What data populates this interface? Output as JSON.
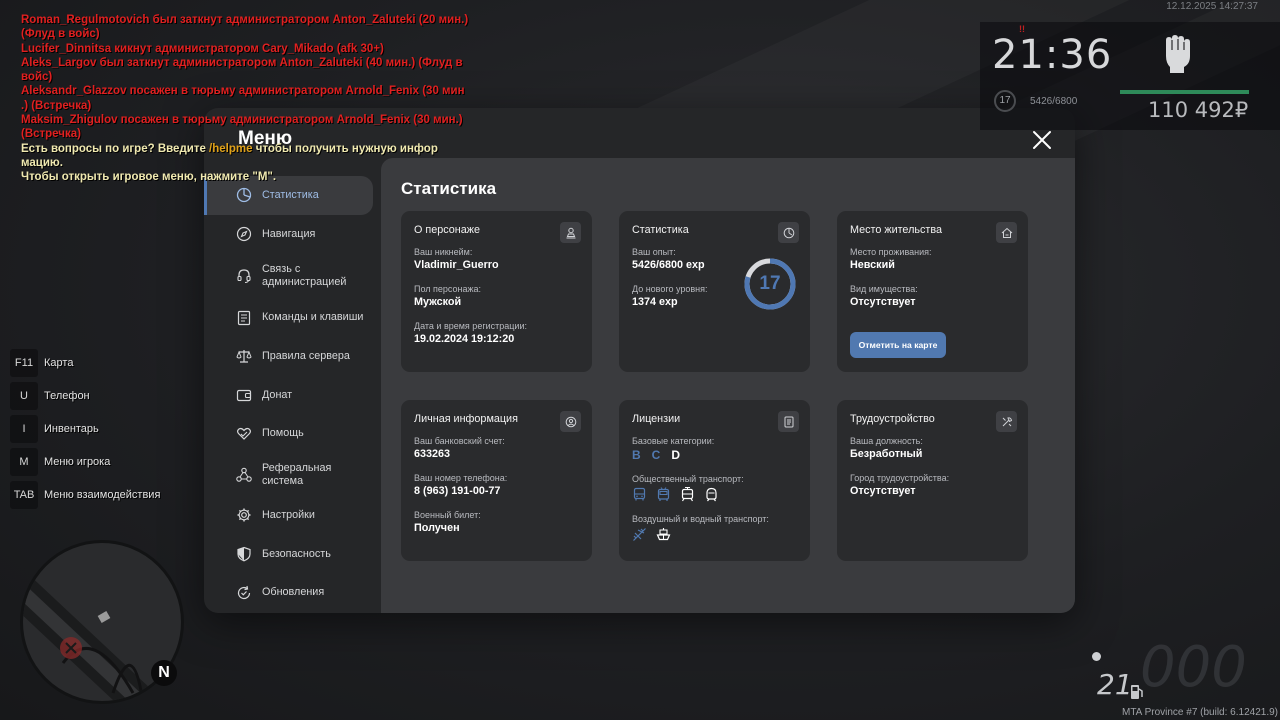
{
  "chat": [
    {
      "color": "red",
      "text": "Roman_Regulmotovich был заткнут администратором Anton_Zaluteki (20 мин.)"
    },
    {
      "color": "red",
      "text": " (Флуд в войс)"
    },
    {
      "color": "red",
      "text": "Lucifer_Dinnitsa кикнут администратором Cary_Mikado (afk 30+)"
    },
    {
      "color": "red",
      "text": "Aleks_Largov был заткнут администратором Anton_Zaluteki (40 мин.) (Флуд в"
    },
    {
      "color": "red",
      "text": " войс)"
    },
    {
      "color": "red",
      "text": "Aleksandr_Glazzov посажен в тюрьму администратором Arnold_Fenix (30 мин"
    },
    {
      "color": "red",
      "text": ".) (Встречка)"
    },
    {
      "color": "red",
      "text": "Maksim_Zhigulov посажен в тюрьму администратором Arnold_Fenix (30 мин.)"
    },
    {
      "color": "red",
      "text": " (Встречка)"
    }
  ],
  "chat_help": {
    "prefix": "Есть вопросы по игре? Введите ",
    "command": "/helpme",
    "suffix": " чтобы получить нужную инфор",
    "line2": "мацию.",
    "line3": "Чтобы открыть игровое меню, нажмите \"M\"."
  },
  "hud": {
    "datetime": "12.12.2025 14:27:37",
    "marker": "!!",
    "time": "21:36",
    "level": "17",
    "exp": "5426/6800",
    "money": "110 492₽",
    "health_fraction": 0.95
  },
  "hints": [
    {
      "key": "F11",
      "label": "Карта"
    },
    {
      "key": "U",
      "label": "Телефон"
    },
    {
      "key": "I",
      "label": "Инвентарь"
    },
    {
      "key": "M",
      "label": "Меню игрока"
    },
    {
      "key": "TAB",
      "label": "Меню взаимодействия"
    }
  ],
  "minimap": {
    "north": "N"
  },
  "speedo": {
    "digits": "000",
    "fuel": "21"
  },
  "build": "MTA Province #7 (build: 6.12421.9)",
  "menu": {
    "title": "Меню",
    "sidebar": [
      {
        "label": "Статистика",
        "icon": "pie-chart-icon",
        "active": true
      },
      {
        "label": "Навигация",
        "icon": "compass-icon"
      },
      {
        "label": "Связь с администрацией",
        "icon": "headset-icon"
      },
      {
        "label": "Команды и клавиши",
        "icon": "list-icon"
      },
      {
        "label": "Правила сервера",
        "icon": "scales-icon"
      },
      {
        "label": "Донат",
        "icon": "wallet-icon"
      },
      {
        "label": "Помощь",
        "icon": "heart-hand-icon"
      },
      {
        "label": "Реферальная система",
        "icon": "network-icon"
      },
      {
        "label": "Настройки",
        "icon": "gear-icon"
      },
      {
        "label": "Безопасность",
        "icon": "shield-icon"
      },
      {
        "label": "Обновления",
        "icon": "refresh-icon"
      }
    ],
    "content_title": "Статистика",
    "cards": {
      "character": {
        "title": "О персонаже",
        "nick_label": "Ваш никнейм:",
        "nick": "Vladimir_Guerro",
        "gender_label": "Пол персонажа:",
        "gender": "Мужской",
        "reg_label": "Дата и время регистрации:",
        "reg": "19.02.2024 19:12:20"
      },
      "stats": {
        "title": "Статистика",
        "exp_label": "Ваш опыт:",
        "exp": "5426/6800 exp",
        "next_label": "До нового уровня:",
        "next": "1374 exp",
        "level": "17",
        "progress": 0.798
      },
      "residence": {
        "title": "Место жительства",
        "place_label": "Место проживания:",
        "place": "Невский",
        "property_label": "Вид имущества:",
        "property": "Отсутствует",
        "button": "Отметить на карте"
      },
      "personal": {
        "title": "Личная информация",
        "bank_label": "Ваш банковский счет:",
        "bank": "633263",
        "phone_label": "Ваш номер телефона:",
        "phone": "8 (963) 191-00-77",
        "military_label": "Военный билет:",
        "military": "Получен"
      },
      "licenses": {
        "title": "Лицензии",
        "base_label": "Базовые категории:",
        "categories": [
          {
            "name": "B",
            "owned": true
          },
          {
            "name": "C",
            "owned": true
          },
          {
            "name": "D",
            "owned": false
          }
        ],
        "public_label": "Общественный транспорт:",
        "public_icons": [
          "bus-icon",
          "trolleybus-icon",
          "tram-icon",
          "metro-icon"
        ],
        "air_label": "Воздушный и водный транспорт:",
        "air_icons": [
          "plane-icon",
          "boat-icon"
        ]
      },
      "job": {
        "title": "Трудоустройство",
        "position_label": "Ваша должность:",
        "position": "Безработный",
        "city_label": "Город трудоустройства:",
        "city": "Отсутствует"
      }
    }
  },
  "colors": {
    "accent": "#5179b0",
    "chat_red": "#e02020",
    "chat_help": "#e0a21a",
    "health": "#2e8a59"
  }
}
